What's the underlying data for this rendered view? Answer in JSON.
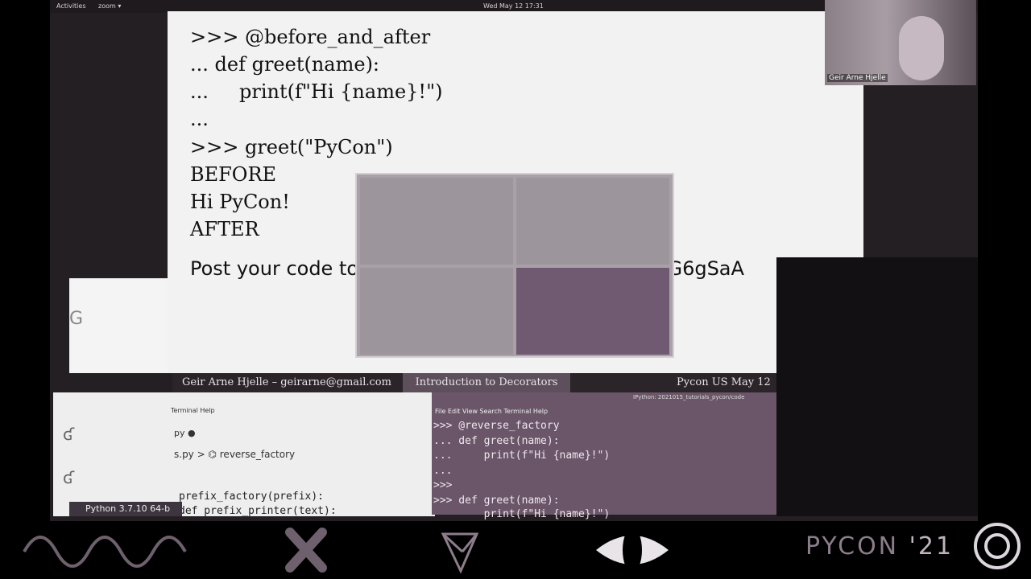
{
  "topbar": {
    "activities": "Activities",
    "zoom": "zoom ▾",
    "clock": "Wed May 12 17:31"
  },
  "slide": {
    "code_lines": [
      ">>> @before_and_after",
      "... def greet(name):",
      "...     print(f\"Hi {name}!\")",
      "...",
      ">>> greet(\"PyCon\")",
      "BEFORE",
      "Hi PyCon!",
      "AFTER"
    ],
    "post_prefix": "Post your code to ",
    "post_url": "https://forms.gle/hW87NFstp24G6gSaA"
  },
  "slide_footer": {
    "author": "Geir Arne Hjelle – geirarne@gmail.com",
    "title": "Introduction to Decorators",
    "event": "Pycon US May 12"
  },
  "vscode": {
    "menu": "Terminal  Help",
    "tab": "py ●",
    "breadcrumb": "s.py > ⌬ reverse_factory",
    "code_line1": "prefix_factory(prefix):",
    "code_line2": "def prefix_printer(text):",
    "status": "Python 3.7.10 64-b"
  },
  "terminal": {
    "title": "IPython: 2021015_tutorials_pycon/code",
    "menu": "File  Edit  View  Search  Terminal  Help",
    "lines": [
      ">>> @reverse_factory",
      "... def greet(name):",
      "...     print(f\"Hi {name}!\")",
      "...",
      ">>>",
      ">>> def greet(name):",
      "        print(f\"Hi {name}!\")"
    ]
  },
  "webcam": {
    "name": "Geir Arne Hjelle"
  },
  "brand": {
    "pycon": "PYCON",
    "year": "'21"
  },
  "colors": {
    "accent": "#8c7d8b",
    "slide_bg": "#f2f2f2",
    "terminal_bg": "#6a5668"
  },
  "icons": {
    "bottom": [
      "wave-icon",
      "x-icon",
      "paper-plane-icon",
      "eye-icon",
      "circle-logo-icon"
    ]
  }
}
